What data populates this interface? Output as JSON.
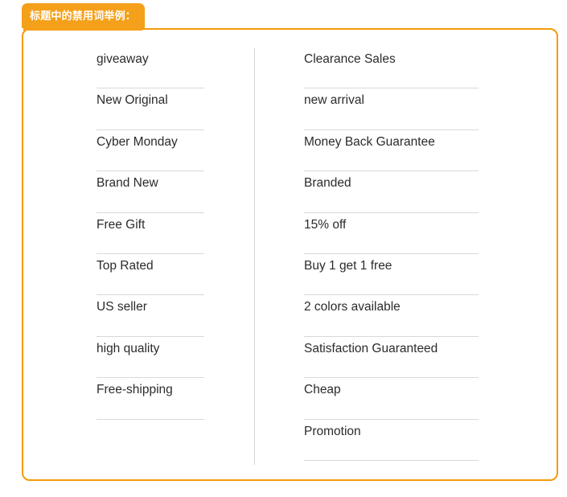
{
  "panel": {
    "tab_label": "标题中的禁用词举例：",
    "accent_color": "#f59a0b",
    "tab_color": "#f5a01a",
    "background_color": "#ffffff",
    "text_color": "#2b2b2b",
    "divider_color": "#d9d9d9"
  },
  "columns": {
    "left": {
      "items": [
        {
          "term": "giveaway"
        },
        {
          "term": "New Original"
        },
        {
          "term": "Cyber Monday"
        },
        {
          "term": "Brand New"
        },
        {
          "term": "Free Gift"
        },
        {
          "term": "Top Rated"
        },
        {
          "term": "US seller"
        },
        {
          "term": "high quality"
        },
        {
          "term": "Free-shipping"
        }
      ]
    },
    "right": {
      "items": [
        {
          "term": "Clearance Sales"
        },
        {
          "term": "new arrival"
        },
        {
          "term": "Money Back Guarantee"
        },
        {
          "term": "Branded"
        },
        {
          "term": "15% off"
        },
        {
          "term": "Buy 1 get 1 free"
        },
        {
          "term": "2 colors available"
        },
        {
          "term": "Satisfaction Guaranteed"
        },
        {
          "term": "Cheap"
        },
        {
          "term": "Promotion"
        }
      ]
    }
  }
}
